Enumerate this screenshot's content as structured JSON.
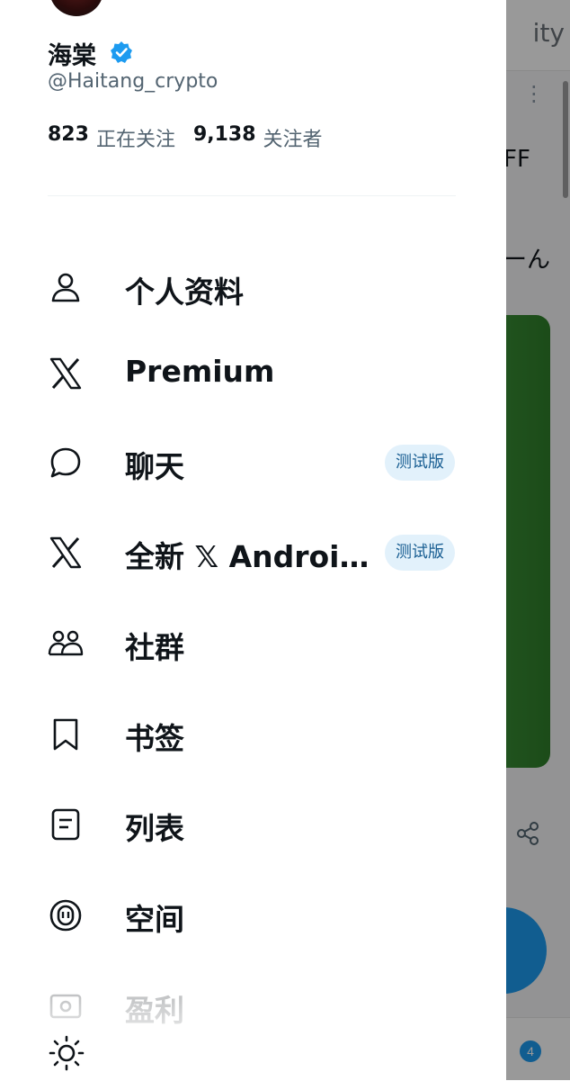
{
  "background": {
    "top_text": "ity",
    "snippet1": "FF",
    "snippet2": "ーん",
    "notification_count": "4"
  },
  "profile": {
    "display_name": "海棠",
    "handle": "@Haitang_crypto",
    "following_count": "823",
    "following_label": "正在关注",
    "followers_count": "9,138",
    "followers_label": "关注者"
  },
  "menu": {
    "items": [
      {
        "label": "个人资料",
        "icon": "person-icon"
      },
      {
        "label": "Premium",
        "icon": "x-logo-icon"
      },
      {
        "label": "聊天",
        "icon": "chat-bubble-icon",
        "badge": "测试版"
      },
      {
        "label": "全新 𝕏 Android...",
        "icon": "x-logo-icon",
        "badge": "测试版"
      },
      {
        "label": "社群",
        "icon": "communities-icon"
      },
      {
        "label": "书签",
        "icon": "bookmark-icon"
      },
      {
        "label": "列表",
        "icon": "list-icon"
      },
      {
        "label": "空间",
        "icon": "spaces-microphone-icon"
      },
      {
        "label": "盈利",
        "icon": "monetization-icon"
      }
    ]
  },
  "colors": {
    "verified_blue": "#1d9bf0",
    "badge_bg": "#e2f1fb",
    "badge_text": "#1a5f93",
    "text_primary": "#0f1419",
    "text_secondary": "#536471"
  }
}
